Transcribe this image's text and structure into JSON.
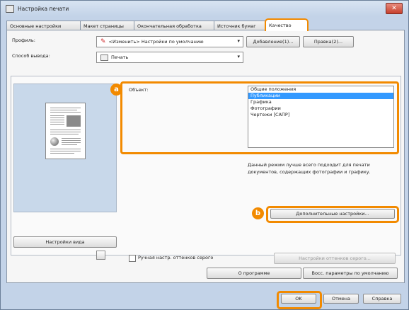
{
  "window": {
    "title": "Настройка печати",
    "close_label": "✕"
  },
  "tabs": [
    {
      "label": "Основные настройки"
    },
    {
      "label": "Макет страницы"
    },
    {
      "label": "Окончательная обработка"
    },
    {
      "label": "Источник бумаг"
    },
    {
      "label": "Качество",
      "active": true
    }
  ],
  "profile": {
    "label": "Профиль:",
    "value": "<Изменить> Настройки по умолчанию",
    "add_button": "Добавление(1)...",
    "edit_button": "Правка(2)..."
  },
  "output": {
    "label": "Способ вывода:",
    "value": "Печать"
  },
  "objective": {
    "label": "Объект:",
    "options": [
      "Общие положения",
      "Публикации",
      "Графика",
      "Фотографии",
      "Чертежи [САПР]"
    ],
    "selected_index": 1,
    "description": "Данный режим лучше всего подходит для печати документов, содержащих фотографии и графику."
  },
  "advanced_button": "Дополнительные настройки...",
  "view_settings_button": "Настройки вида",
  "grayscale": {
    "checkbox_label": "Ручная настр. оттенков серого",
    "checked": false,
    "settings_button": "Настройки оттенков серого..."
  },
  "about_button": "О программе",
  "restore_button": "Восс. параметры по умолчанию",
  "footer": {
    "ok": "OK",
    "cancel": "Отмена",
    "help": "Справка"
  },
  "badges": {
    "a": "a",
    "b": "b"
  },
  "colors": {
    "accent": "#f28a00",
    "selection": "#3399ff",
    "background": "#c9d6e6"
  }
}
